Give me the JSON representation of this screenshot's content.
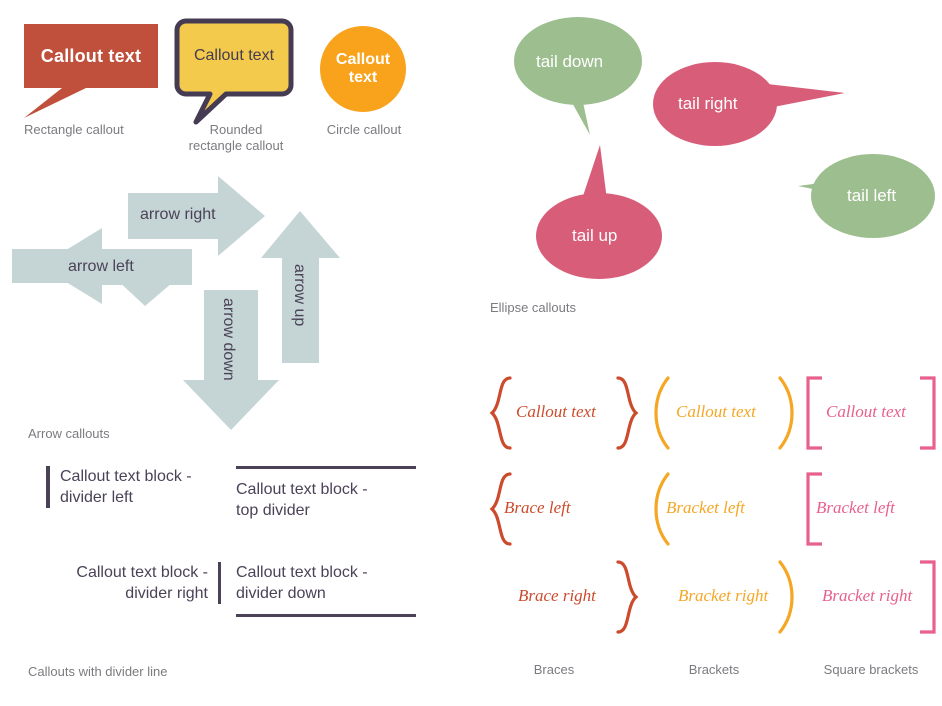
{
  "colors": {
    "rectangle_callout": "#c0503c",
    "rounded_callout_fill": "#f3ca4c",
    "rounded_callout_stroke": "#453b53",
    "circle_callout": "#f9a21b",
    "arrow_fill": "#c5d5d5",
    "arrow_text": "#4b4257",
    "divider_line": "#4b4257",
    "ellipse_green": "#9dbe8f",
    "ellipse_pink": "#d85d78",
    "brace_red": "#cc4b2c",
    "bracket_orange": "#f5a623",
    "square_bracket_pink": "#e8608c",
    "caption_gray": "#7b7b80",
    "background": "#ffffff"
  },
  "shape_callouts": {
    "rectangle": {
      "text": "Callout text",
      "caption": "Rectangle callout"
    },
    "rounded": {
      "text": "Callout text",
      "caption": "Rounded\nrectangle callout"
    },
    "circle": {
      "text": "Callout\ntext",
      "caption": "Circle callout"
    }
  },
  "arrow_callouts": {
    "caption": "Arrow callouts",
    "items": [
      {
        "name": "arrow-right",
        "label": "arrow right",
        "direction": "right"
      },
      {
        "name": "arrow-left",
        "label": "arrow left",
        "direction": "left"
      },
      {
        "name": "arrow-up",
        "label": "arrow up",
        "direction": "up"
      },
      {
        "name": "arrow-down",
        "label": "arrow down",
        "direction": "down"
      }
    ]
  },
  "divider_callouts": {
    "caption": "Callouts with divider line",
    "items": [
      {
        "name": "divider-left",
        "text": "Callout text block -\ndivider left"
      },
      {
        "name": "top-divider",
        "text": "Callout text block -\ntop divider"
      },
      {
        "name": "divider-right",
        "text": "Callout text block -\ndivider right"
      },
      {
        "name": "divider-down",
        "text": "Callout text block -\ndivider down"
      }
    ]
  },
  "ellipse_callouts": {
    "caption": "Ellipse callouts",
    "items": [
      {
        "name": "tail-down",
        "label": "tail down",
        "color": "green"
      },
      {
        "name": "tail-right",
        "label": "tail right",
        "color": "pink"
      },
      {
        "name": "tail-up",
        "label": "tail up",
        "color": "pink"
      },
      {
        "name": "tail-left",
        "label": "tail left",
        "color": "green"
      }
    ]
  },
  "bracket_callouts": {
    "columns": [
      {
        "name": "braces",
        "caption": "Braces",
        "color": "#cc4b2c",
        "rows": [
          "Callout text",
          "Brace left",
          "Brace right"
        ]
      },
      {
        "name": "brackets",
        "caption": "Brackets",
        "color": "#f5a623",
        "rows": [
          "Callout text",
          "Bracket left",
          "Bracket right"
        ]
      },
      {
        "name": "square-brackets",
        "caption": "Square brackets",
        "color": "#e8608c",
        "rows": [
          "Callout text",
          "Bracket left",
          "Bracket right"
        ]
      }
    ]
  }
}
